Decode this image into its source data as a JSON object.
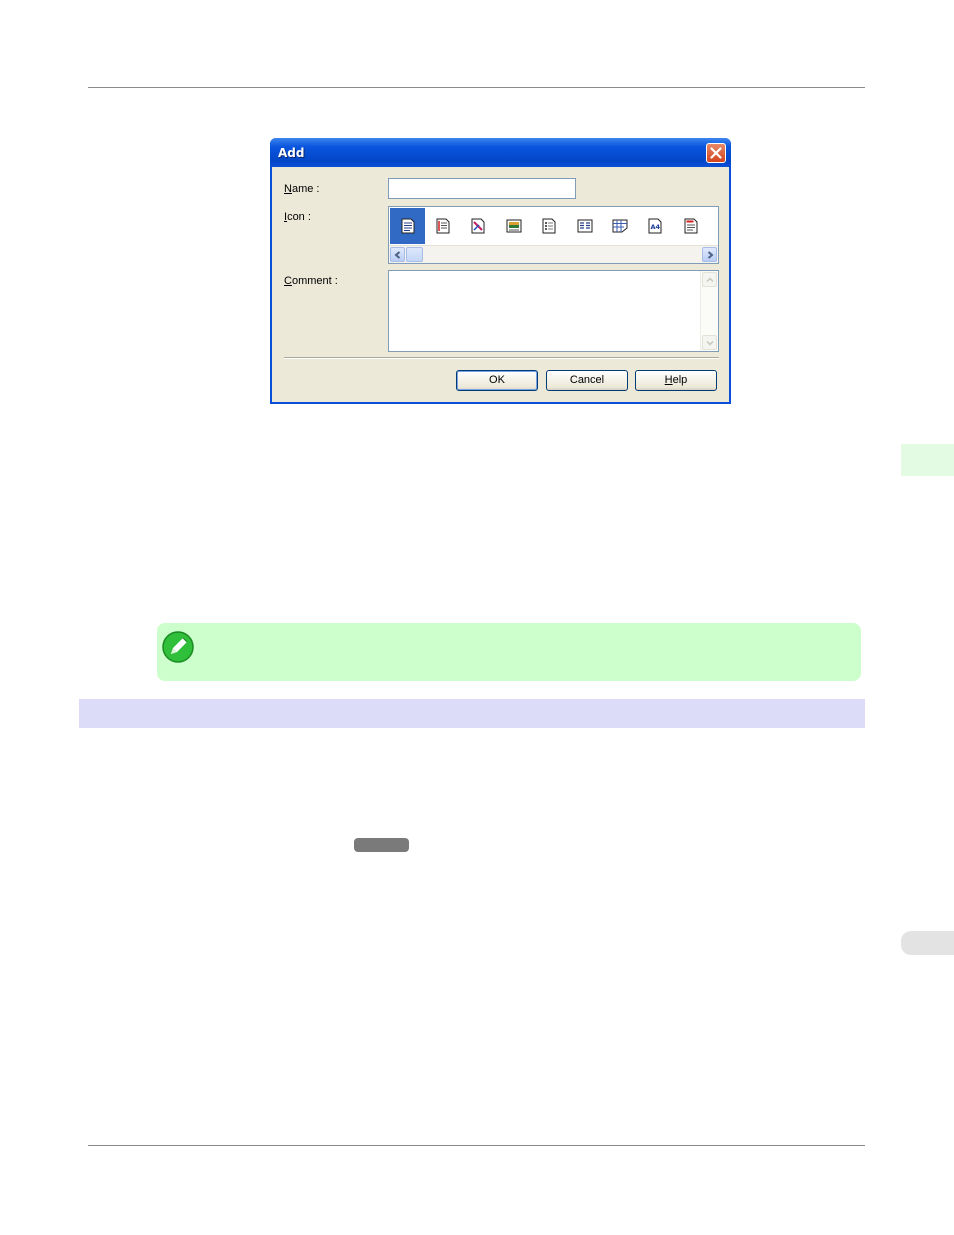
{
  "dialog": {
    "title": "Add",
    "name_label_key": "N",
    "name_label_rest": "ame :",
    "name_value": "",
    "icon_label_key": "I",
    "icon_label_rest": "con :",
    "comment_label_key": "C",
    "comment_label_rest": "omment :",
    "comment_value": "",
    "icons": [
      "document-lines-icon",
      "document-red-margin-icon",
      "document-image-icon",
      "document-photo-icon",
      "document-list-icon",
      "document-columns-icon",
      "document-grid-icon",
      "document-a4-icon",
      "document-red-header-icon"
    ],
    "selected_icon_index": 0,
    "a4_text": "A4",
    "ok_label": "OK",
    "cancel_label": "Cancel",
    "help_label_key": "H",
    "help_label_rest": "elp"
  },
  "colors": {
    "titlebar": "#0a55df",
    "note_bg": "#ccffcc",
    "section_bar": "#dcdcf8",
    "side_tab": "#e2fbe2"
  }
}
